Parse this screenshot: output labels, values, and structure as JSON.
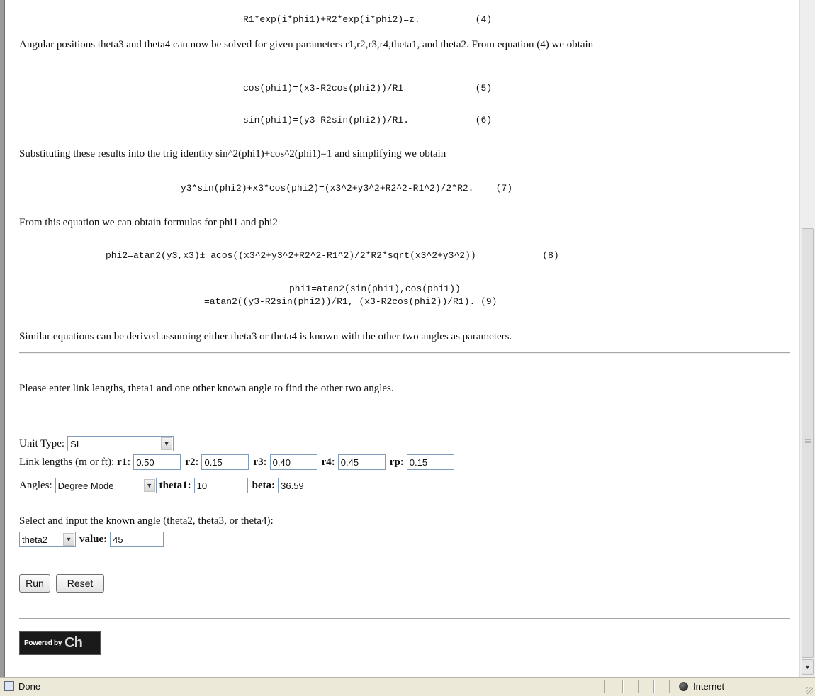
{
  "equations": {
    "eq4": "R1*exp(i*phi1)+R2*exp(i*phi2)=z.          (4)",
    "eq5": "cos(phi1)=(x3-R2cos(phi2))/R1             (5)",
    "eq6": "sin(phi1)=(y3-R2sin(phi2))/R1.            (6)",
    "eq7": "y3*sin(phi2)+x3*cos(phi2)=(x3^2+y3^2+R2^2-R1^2)/2*R2.    (7)",
    "eq8": "phi2=atan2(y3,x3)± acos((x3^2+y3^2+R2^2-R1^2)/2*R2*sqrt(x3^2+y3^2))            (8)",
    "eq9a": "phi1=atan2(sin(phi1),cos(phi1))",
    "eq9b": "=atan2((y3-R2sin(phi2))/R1, (x3-R2cos(phi2))/R1). (9)"
  },
  "paragraphs": {
    "p1": "Angular positions theta3 and theta4 can now be solved for given parameters r1,r2,r3,r4,theta1, and theta2. From equation (4) we obtain",
    "p2": "Substituting these results into the trig identity sin^2(phi1)+cos^2(phi1)=1 and simplifying we obtain",
    "p3": "From this equation we can obtain formulas for phi1 and phi2",
    "p4": "Similar equations can be derived assuming either theta3 or theta4 is known with the other two angles as parameters.",
    "instructions": "Please enter link lengths, theta1 and one other known angle to find the other two angles."
  },
  "form": {
    "unit_type_label": "Unit Type:",
    "unit_type_value": "SI",
    "link_lengths_label": "Link lengths (m or ft):",
    "r1_label": "r1:",
    "r1_value": "0.50",
    "r2_label": "r2:",
    "r2_value": "0.15",
    "r3_label": "r3:",
    "r3_value": "0.40",
    "r4_label": "r4:",
    "r4_value": "0.45",
    "rp_label": "rp:",
    "rp_value": "0.15",
    "angles_label": "Angles:",
    "angle_mode_value": "Degree Mode",
    "theta1_label": "theta1:",
    "theta1_value": "10",
    "beta_label": "beta:",
    "beta_value": "36.59",
    "known_angle_prompt": "Select and input the known angle (theta2, theta3, or theta4):",
    "known_angle_select_value": "theta2",
    "value_label": "value:",
    "value_value": "45",
    "run_label": "Run",
    "reset_label": "Reset"
  },
  "powered": {
    "text": "Powered by",
    "brand": "Ch"
  },
  "statusbar": {
    "status_text": "Done",
    "zone_text": "Internet"
  }
}
